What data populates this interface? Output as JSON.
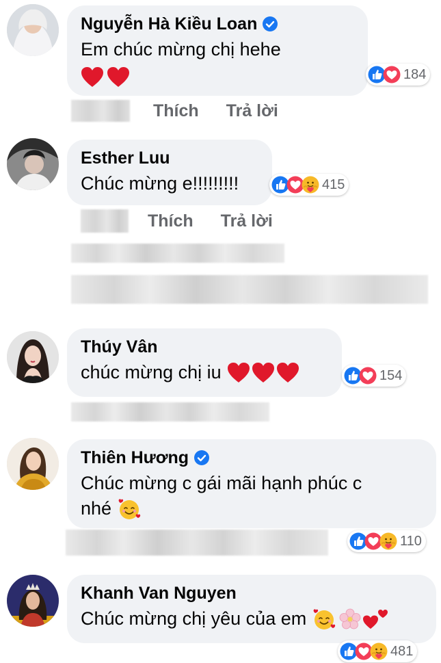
{
  "comments": [
    {
      "author": "Nguyễn Hà Kiều Loan",
      "verified": true,
      "text": "Em chúc mừng chị hehe",
      "emojis": [
        "red-heart",
        "red-heart"
      ],
      "reactions": [
        "like",
        "love"
      ],
      "reaction_count": "184",
      "actions": {
        "like": "Thích",
        "reply": "Trả lời"
      }
    },
    {
      "author": "Esther Luu",
      "verified": false,
      "text": "Chúc mừng e!!!!!!!!!",
      "emojis": [],
      "reactions": [
        "like",
        "love",
        "care"
      ],
      "reaction_count": "415",
      "actions": {
        "like": "Thích",
        "reply": "Trả lời"
      }
    },
    {
      "author": "Thúy Vân",
      "verified": false,
      "text": "chúc mừng chị iu",
      "emojis": [
        "red-heart",
        "red-heart",
        "red-heart"
      ],
      "reactions": [
        "like",
        "love"
      ],
      "reaction_count": "154"
    },
    {
      "author": "Thiên Hương",
      "verified": true,
      "text_line1": "Chúc mừng c gái mãi hạnh phúc c",
      "text_line2": "nhé",
      "emojis": [
        "smiling-face-with-hearts"
      ],
      "reactions": [
        "like",
        "love",
        "care"
      ],
      "reaction_count": "110"
    },
    {
      "author": "Khanh Van Nguyen",
      "verified": false,
      "text": "Chúc mừng chị yêu của em",
      "emojis": [
        "smiling-face-with-hearts",
        "cherry-blossom",
        "two-hearts"
      ],
      "reactions": [
        "like",
        "love",
        "care"
      ],
      "reaction_count": "481"
    }
  ],
  "colors": {
    "bubble": "#f0f2f5",
    "verified_blue": "#1877f2",
    "like_blue": "#1877f2",
    "love_red": "#f33e58",
    "muted_text": "#65676b"
  }
}
